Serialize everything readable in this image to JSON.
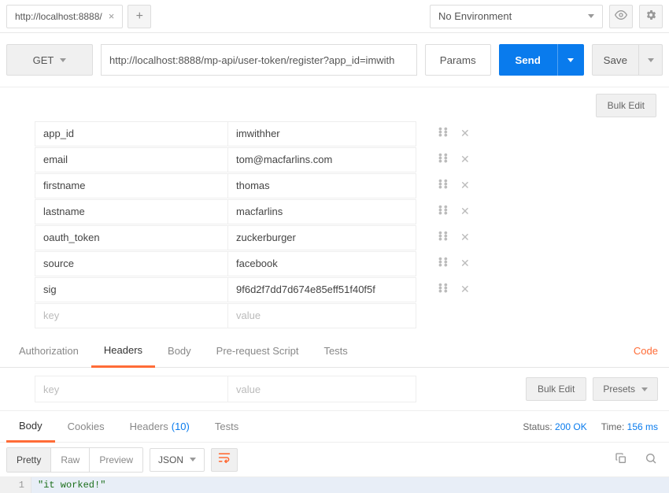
{
  "tab": {
    "title": "http://localhost:8888/"
  },
  "environment": {
    "selected": "No Environment"
  },
  "request": {
    "method": "GET",
    "url": "http://localhost:8888/mp-api/user-token/register?app_id=imwith",
    "params_label": "Params",
    "send_label": "Send",
    "save_label": "Save"
  },
  "params": {
    "bulk_edit": "Bulk Edit",
    "rows": [
      {
        "key": "app_id",
        "value": "imwithher"
      },
      {
        "key": "email",
        "value": "tom@macfarlins.com"
      },
      {
        "key": "firstname",
        "value": "thomas"
      },
      {
        "key": "lastname",
        "value": "macfarlins"
      },
      {
        "key": "oauth_token",
        "value": "zuckerburger"
      },
      {
        "key": "source",
        "value": "facebook"
      },
      {
        "key": "sig",
        "value": "9f6d2f7dd7d674e85eff51f40f5f"
      }
    ],
    "placeholder_key": "key",
    "placeholder_value": "value"
  },
  "req_tabs": {
    "authorization": "Authorization",
    "headers": "Headers",
    "body": "Body",
    "pre_request": "Pre-request Script",
    "tests": "Tests",
    "code": "Code"
  },
  "headers": {
    "placeholder_key": "key",
    "placeholder_value": "value",
    "bulk_edit": "Bulk Edit",
    "presets": "Presets"
  },
  "resp_tabs": {
    "body": "Body",
    "cookies": "Cookies",
    "headers": "Headers",
    "headers_count": "(10)",
    "tests": "Tests"
  },
  "status": {
    "status_label": "Status:",
    "status_value": "200 OK",
    "time_label": "Time:",
    "time_value": "156 ms"
  },
  "view": {
    "pretty": "Pretty",
    "raw": "Raw",
    "preview": "Preview",
    "format": "JSON"
  },
  "response_body": {
    "line_no": "1",
    "content": "\"it worked!\""
  }
}
